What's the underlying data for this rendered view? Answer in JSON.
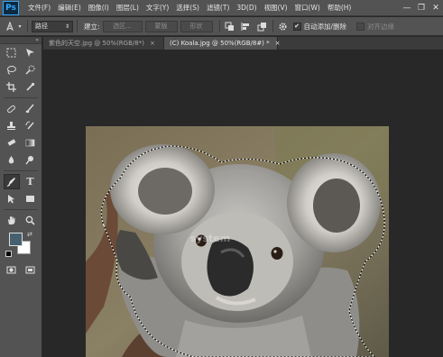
{
  "app": {
    "logo": "Ps"
  },
  "menu": {
    "items": [
      "文件(F)",
      "编辑(E)",
      "图像(I)",
      "图层(L)",
      "文字(Y)",
      "选择(S)",
      "滤镜(T)",
      "3D(D)",
      "视图(V)",
      "窗口(W)",
      "帮助(H)"
    ]
  },
  "window_controls": {
    "minimize": "—",
    "restore": "❐",
    "close": "✕"
  },
  "options_bar": {
    "tool_icon": "pen-icon",
    "mode_select": "路径",
    "build_label": "建立:",
    "selection_button": "选区...",
    "mask_button": "蒙版",
    "shape_button": "形状",
    "auto_add_delete_label": "自动添加/删除",
    "auto_add_delete_checked": true,
    "align_edges_label": "对齐边缘",
    "align_edges_checked": false
  },
  "tabs": [
    {
      "label": "紫色的天空.jpg @ 50%(RGB/8*)",
      "close": "×",
      "active": false
    },
    {
      "label": "(C) Koala.jpg @ 50%(RGB/8#) *",
      "close": "×",
      "active": true
    }
  ],
  "colors": {
    "foreground": "#46606f",
    "background": "#ffffff",
    "ui_panel": "#535353",
    "workspace": "#282828"
  },
  "canvas": {
    "watermark": "system"
  }
}
